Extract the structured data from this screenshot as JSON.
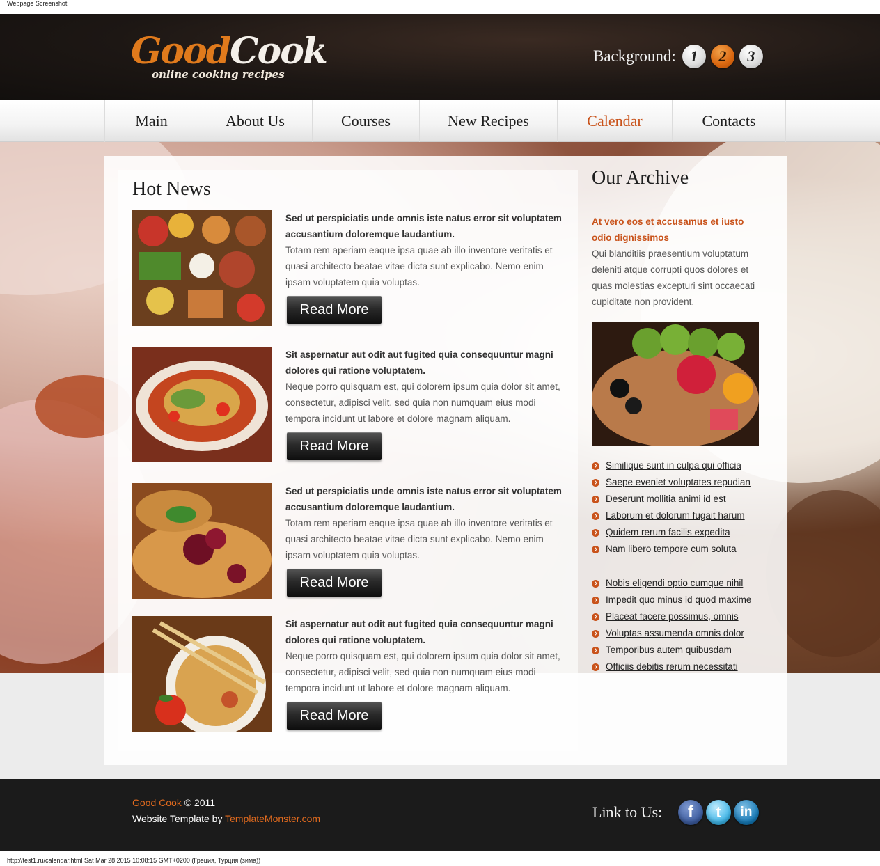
{
  "window": {
    "capture_title": "Webpage Screenshot"
  },
  "header": {
    "logo_good": "Good",
    "logo_cook": "Cook",
    "logo_tagline": "online cooking recipes",
    "background_label": "Background:",
    "background_options": [
      "1",
      "2",
      "3"
    ],
    "background_selected": "2"
  },
  "nav": {
    "items": [
      {
        "label": "Main"
      },
      {
        "label": "About Us"
      },
      {
        "label": "Courses"
      },
      {
        "label": "New Recipes"
      },
      {
        "label": "Calendar"
      },
      {
        "label": "Contacts"
      }
    ],
    "current": "Calendar"
  },
  "news": {
    "title": "Hot News",
    "items": [
      {
        "headline": "Sed ut perspiciatis unde omnis iste natus error sit voluptatem accusantium doloremque laudantium.",
        "body": "Totam rem aperiam eaque ipsa quae ab illo inventore veritatis et quasi architecto beatae vitae dicta sunt explicabo. Nemo enim ipsam voluptatem quia voluptas.",
        "button": "Read More",
        "image_icon": "food-spread-photo"
      },
      {
        "headline": "Sit aspernatur aut odit aut fugited quia consequuntur magni dolores qui ratione voluptatem.",
        "body": "Neque porro quisquam est, qui dolorem ipsum quia dolor sit amet, consectetur, adipisci velit, sed quia non numquam eius modi tempora incidunt ut labore et dolore magnam aliquam.",
        "button": "Read More",
        "image_icon": "papaya-salad-photo"
      },
      {
        "headline": "Sed ut perspiciatis unde omnis iste natus error sit voluptatem accusantium doloremque laudantium.",
        "body": "Totam rem aperiam eaque ipsa quae ab illo inventore veritatis et quasi architecto beatae vitae dicta sunt explicabo. Nemo enim ipsam voluptatem quia voluptas.",
        "button": "Read More",
        "image_icon": "berry-pancakes-photo"
      },
      {
        "headline": "Sit aspernatur aut odit aut fugited quia consequuntur magni dolores qui ratione voluptatem.",
        "body": "Neque porro quisquam est, qui dolorem ipsum quia dolor sit amet, consectetur, adipisci velit, sed quia non numquam eius modi tempora incidunt ut labore et dolore magnam aliquam.",
        "button": "Read More",
        "image_icon": "noodles-chopsticks-photo"
      }
    ]
  },
  "archive": {
    "title": "Our Archive",
    "headline": "At vero eos et accusamus et iusto odio dignissimos",
    "body": "Qui blanditiis praesentium voluptatum deleniti atque corrupti quos dolores et quas molestias excepturi sint occaecati cupiditate non provident.",
    "image_icon": "fruit-salad-photo",
    "links_1": [
      "Similique sunt in culpa qui officia",
      "Saepe eveniet voluptates repudian",
      "Deserunt mollitia animi id est",
      "Laborum et dolorum fugait harum",
      "Quidem rerum facilis expedita",
      "Nam libero tempore cum soluta"
    ],
    "links_2": [
      "Nobis eligendi optio cumque nihil",
      "Impedit quo minus id quod maxime",
      "Placeat facere possimus, omnis",
      "Voluptas assumenda omnis dolor",
      "Temporibus autem quibusdam",
      "Officiis debitis rerum necessitati"
    ]
  },
  "footer": {
    "brand": "Good Cook",
    "copyright": "© 2011",
    "credit_prefix": "Website Template by",
    "credit_link": "TemplateMonster.com",
    "link_to_label": "Link to Us:",
    "social": [
      {
        "icon": "facebook-icon",
        "glyph": "f"
      },
      {
        "icon": "twitter-icon",
        "glyph": "t"
      },
      {
        "icon": "linkedin-icon",
        "glyph": "in"
      }
    ]
  },
  "status_bar": "http://test1.ru/calendar.html Sat Mar 28 2015 10:08:15 GMT+0200 (Греция, Турция (зима))",
  "colors": {
    "accent": "#c9531b",
    "logo_orange": "#e07a1c",
    "header_dark": "#1d1714",
    "footer_dark": "#1b1b1b"
  }
}
